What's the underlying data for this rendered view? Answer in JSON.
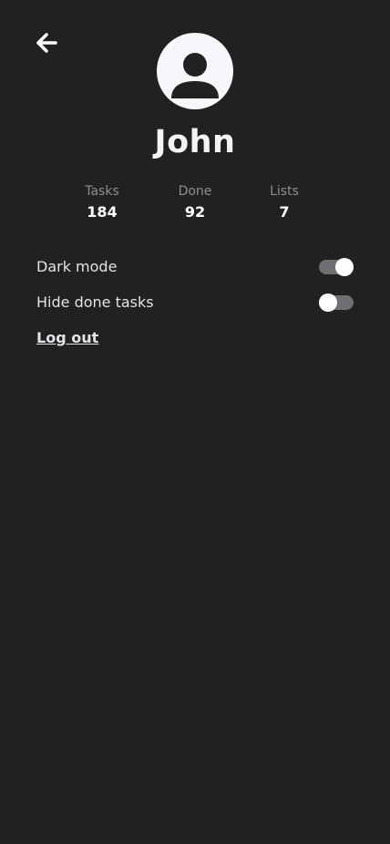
{
  "header": {
    "back_icon": "arrow-left-icon",
    "avatar_icon": "user-silhouette-icon"
  },
  "profile": {
    "name": "John"
  },
  "stats": [
    {
      "label": "Tasks",
      "value": "184"
    },
    {
      "label": "Done",
      "value": "92"
    },
    {
      "label": "Lists",
      "value": "7"
    }
  ],
  "settings": [
    {
      "label": "Dark mode",
      "enabled": true
    },
    {
      "label": "Hide done tasks",
      "enabled": false
    }
  ],
  "actions": {
    "logout_label": "Log out"
  },
  "colors": {
    "background": "#212121",
    "text": "#e3e3e8",
    "muted_text": "#8e8e93",
    "toggle_track": "#6e6e73",
    "toggle_knob": "#ffffff",
    "avatar_background": "#f7f7fb"
  }
}
